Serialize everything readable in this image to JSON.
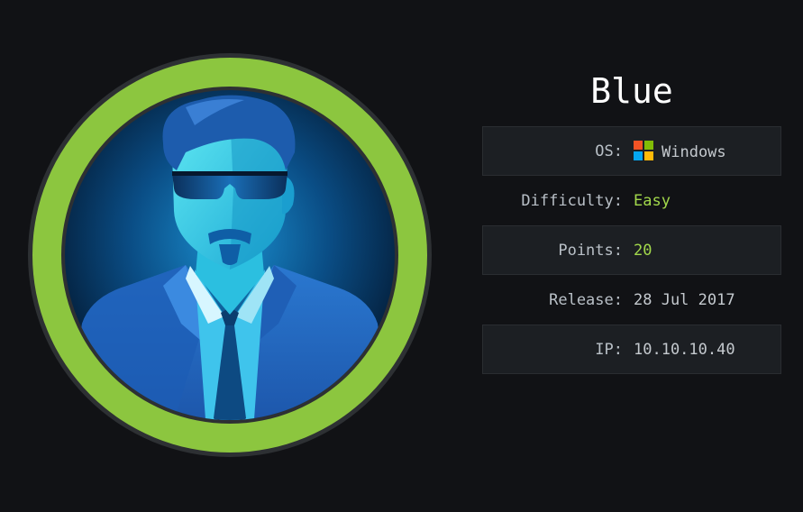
{
  "machine": {
    "name": "Blue",
    "avatar": "hacker-agent-avatar",
    "ring_color": "#8cc63f"
  },
  "info": [
    {
      "label": "OS:",
      "value": "Windows",
      "icon": "windows-logo-icon",
      "accent": false
    },
    {
      "label": "Difficulty:",
      "value": "Easy",
      "accent": true
    },
    {
      "label": "Points:",
      "value": "20",
      "accent": true
    },
    {
      "label": "Release:",
      "value": "28 Jul 2017",
      "accent": false
    },
    {
      "label": "IP:",
      "value": "10.10.10.40",
      "accent": false
    }
  ],
  "colors": {
    "background": "#111215",
    "accent_green": "#a2d84b",
    "row_shade": "#1c1f23"
  }
}
